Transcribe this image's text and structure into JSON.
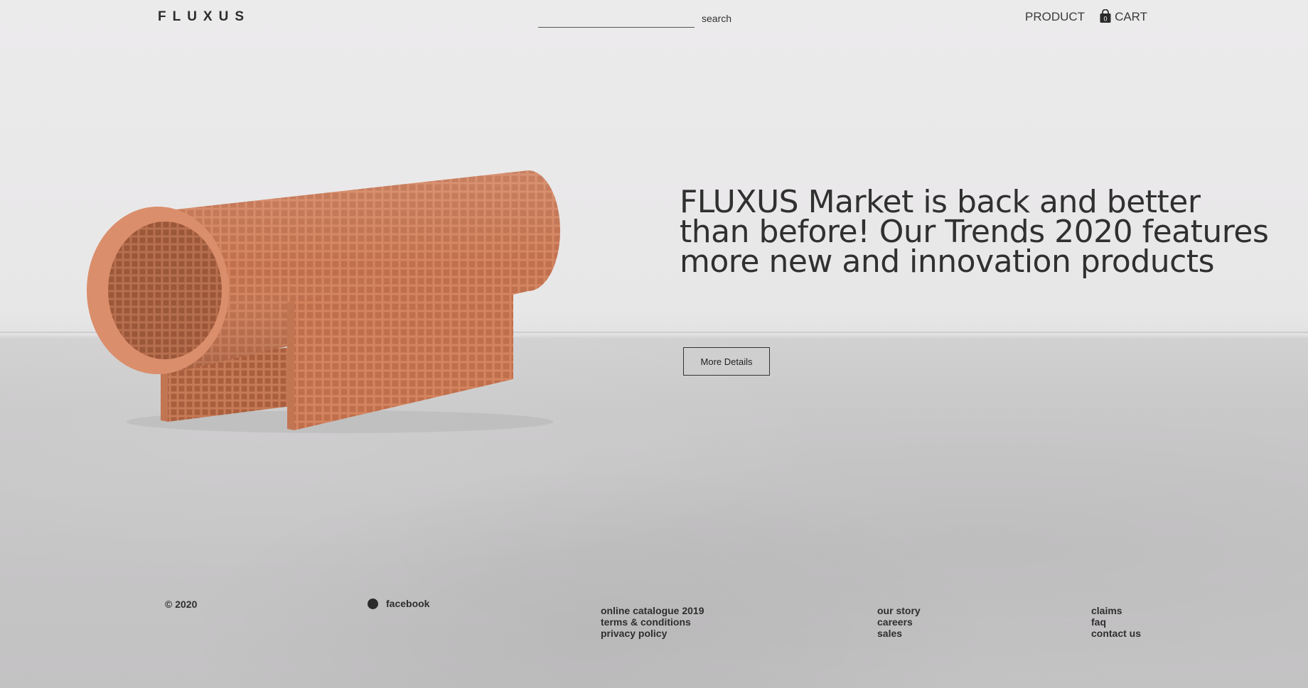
{
  "header": {
    "logo": "FLUXUS",
    "search": {
      "value": "",
      "placeholder": "",
      "label": "search"
    },
    "nav": {
      "product": "PRODUCT",
      "cart": "CART",
      "cart_count": "0"
    }
  },
  "hero": {
    "title": "FLUXUS Market is back and better than before! Our Trends 2020 features more new and innovation products",
    "button_label": "More Details"
  },
  "footer": {
    "copyright": "© 2020",
    "social_label": "facebook",
    "columns": [
      {
        "links": [
          "online catalogue 2019",
          "terms & conditions",
          "privacy policy"
        ]
      },
      {
        "links": [
          "our story",
          "careers",
          "sales"
        ]
      },
      {
        "links": [
          "claims",
          "faq",
          "contact us"
        ]
      }
    ]
  },
  "colors": {
    "product_terracotta": "#d98866",
    "text_dark": "#303030",
    "wall": "#ecebec",
    "floor": "#c9c8c9"
  }
}
